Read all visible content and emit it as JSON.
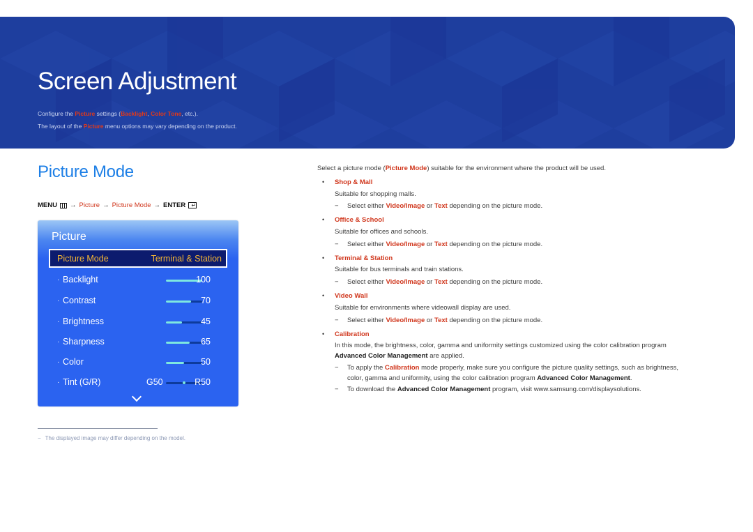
{
  "banner": {
    "title": "Screen Adjustment",
    "line1": {
      "pre": "Configure the ",
      "picture": "Picture",
      "mid": " settings (",
      "backlight": "Backlight",
      "comma": ", ",
      "color_tone": "Color Tone",
      "post": ", etc.)."
    },
    "line2": {
      "pre": "The layout of the ",
      "picture": "Picture",
      "post": " menu options may vary depending on the product."
    }
  },
  "section": {
    "title": "Picture Mode",
    "path": {
      "menu": "MENU",
      "arrow": "→",
      "picture": "Picture",
      "picture_mode": "Picture Mode",
      "enter": "ENTER"
    }
  },
  "osd": {
    "title": "Picture",
    "selected": {
      "label": "Picture Mode",
      "value": "Terminal & Station"
    },
    "rows": [
      {
        "label": "Backlight",
        "value": "100",
        "percent": 100
      },
      {
        "label": "Contrast",
        "value": "70",
        "percent": 70
      },
      {
        "label": "Brightness",
        "value": "45",
        "percent": 45
      },
      {
        "label": "Sharpness",
        "value": "65",
        "percent": 65
      },
      {
        "label": "Color",
        "value": "50",
        "percent": 50
      }
    ],
    "tint": {
      "label": "Tint (G/R)",
      "left": "G50",
      "right": "R50",
      "position": 50
    },
    "more_icon": "chevron-down-icon"
  },
  "footnote": {
    "dash": "−",
    "text": "The displayed image may differ depending on the model."
  },
  "content": {
    "intro": {
      "pre": "Select a picture mode (",
      "key": "Picture Mode",
      "post": ") suitable for the environment where the product will be used."
    },
    "bullet": "•",
    "dash": "−",
    "note": {
      "pre": "Select either ",
      "video": "Video/Image",
      "or": " or ",
      "text": "Text",
      "post": " depending on the picture mode."
    },
    "items": [
      {
        "title": "Shop & Mall",
        "desc": "Suitable for shopping malls."
      },
      {
        "title": "Office & School",
        "desc": "Suitable for offices and schools."
      },
      {
        "title": "Terminal & Station",
        "desc": "Suitable for bus terminals and train stations."
      },
      {
        "title": "Video Wall",
        "desc": "Suitable for environments where videowall display are used."
      }
    ],
    "calibration": {
      "title": "Calibration",
      "desc1": "In this mode, the brightness, color, gamma and uniformity settings customized using the color calibration program",
      "desc2_key": "Advanced Color Management",
      "desc2_post": " are applied.",
      "note1_pre": "To apply the ",
      "note1_key": "Calibration",
      "note1_post": " mode properly, make sure you configure the picture quality settings, such as brightness,",
      "note1_line2_pre": "color, gamma and uniformity, using the color calibration program ",
      "note1_line2_key": "Advanced Color Management",
      "note1_line2_post": ".",
      "note2_pre": "To download the ",
      "note2_key": "Advanced Color Management",
      "note2_post": " program, visit www.samsung.com/displaysolutions."
    }
  }
}
